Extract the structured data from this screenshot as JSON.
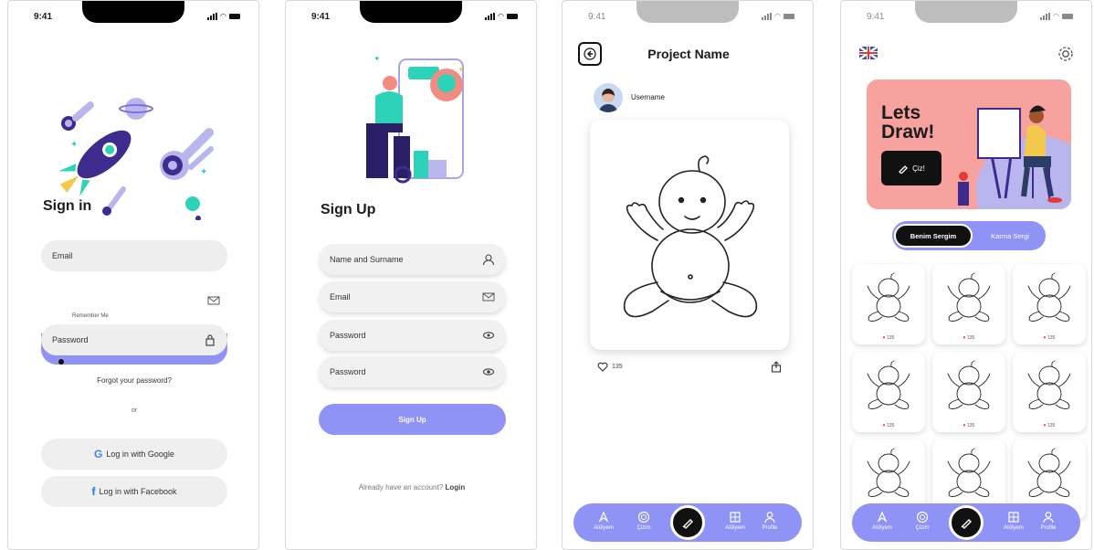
{
  "status": {
    "time": "9:41"
  },
  "signin": {
    "title": "Sign in",
    "email_placeholder": "Email",
    "remember_label": "Remember Me",
    "password_placeholder": "Password",
    "forgot_label": "Forgot your password?",
    "or_label": "or",
    "google_label": "Log in with Google",
    "facebook_label": "Log in with Facebook"
  },
  "signup": {
    "title": "Sign Up",
    "name_placeholder": "Name and Surname",
    "email_placeholder": "Email",
    "password_placeholder": "Password",
    "password2_placeholder": "Password",
    "button_label": "Sign Up",
    "account_prefix": "Already have an account?",
    "login_link": "Login"
  },
  "project": {
    "title": "Project Name",
    "username": "Username",
    "likes": "135"
  },
  "nav": {
    "item1": "Atölyem",
    "item2": "Çizim",
    "item3": "Atölyem",
    "item4": "Profile"
  },
  "home": {
    "banner_title_line1": "Lets",
    "banner_title_line2": "Draw!",
    "draw_button": "Çiz!",
    "tab_active": "Benim Sergim",
    "tab_inactive": "Karma Sergi",
    "thumb_likes": [
      "135",
      "135",
      "135",
      "135",
      "135",
      "135"
    ]
  },
  "colors": {
    "accent": "#8e93f5",
    "banner": "#f7a29e",
    "dark": "#111111"
  }
}
